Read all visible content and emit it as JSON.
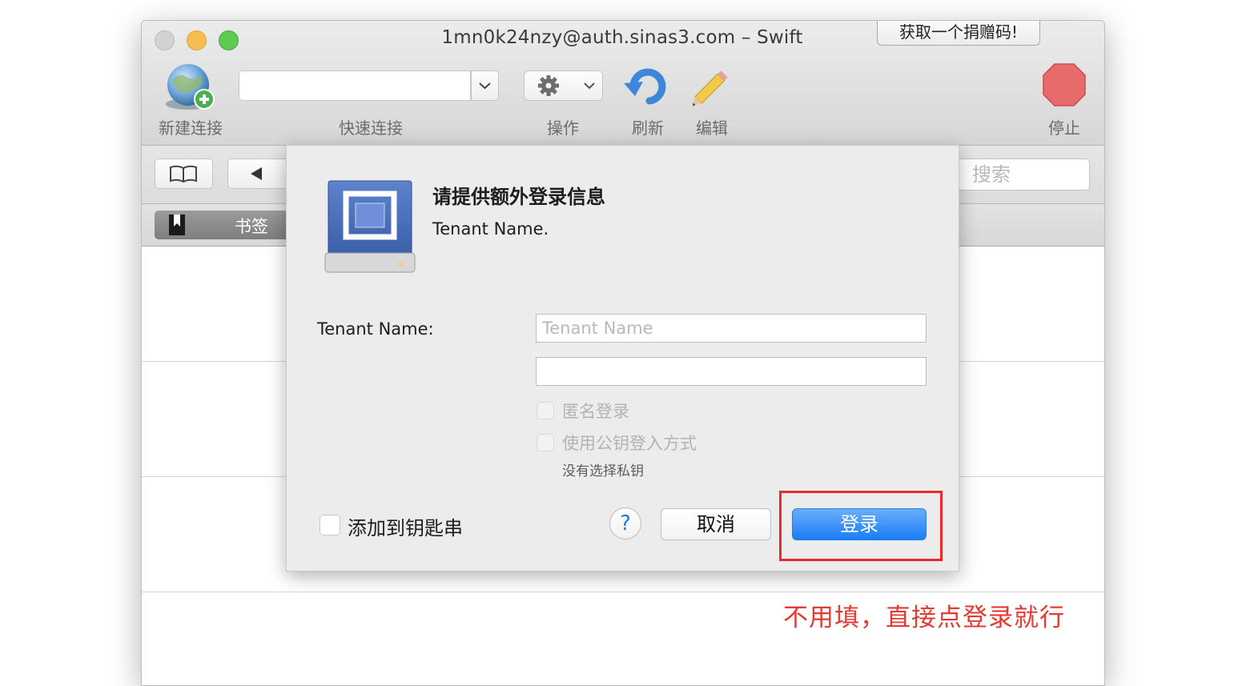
{
  "window": {
    "title": "1mn0k24nzy@auth.sinas3.com – Swift",
    "donate_label": "获取一个捐赠码!"
  },
  "toolbar": {
    "new_connection": "新建连接",
    "quick_connect": "快速连接",
    "action": "操作",
    "refresh": "刷新",
    "edit": "编辑",
    "stop": "停止"
  },
  "navbar": {
    "search_placeholder": "搜索"
  },
  "bookmarks": {
    "tab_label": "书签"
  },
  "dialog": {
    "title": "请提供额外登录信息",
    "subtitle": "Tenant Name.",
    "field_label": "Tenant Name:",
    "field_placeholder": "Tenant Name",
    "second_field_value": "",
    "anonymous_login": "匿名登录",
    "use_public_key": "使用公钥登入方式",
    "no_private_key": "没有选择私钥",
    "add_to_keychain": "添加到钥匙串",
    "help": "?",
    "cancel": "取消",
    "login": "登录"
  },
  "annotation": {
    "text": "不用填，直接点登录就行",
    "color": "#e33a32"
  },
  "colors": {
    "accent": "#1b7df5",
    "highlight": "#e82a2a"
  }
}
